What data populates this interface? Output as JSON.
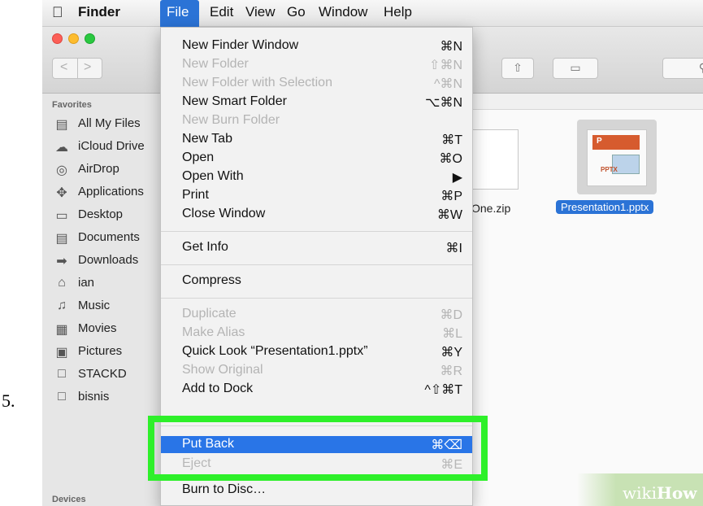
{
  "step_number": "5.",
  "menubar": {
    "apple_icon": "apple-logo",
    "app_name": "Finder",
    "items": [
      "File",
      "Edit",
      "View",
      "Go",
      "Window",
      "Help"
    ]
  },
  "toolbar": {
    "back_icon": "<",
    "forward_icon": ">",
    "share_icon": "share-icon",
    "tag_icon": "tag-icon",
    "search_icon": "search-icon"
  },
  "sidebar": {
    "favorites_heading": "Favorites",
    "devices_heading": "Devices",
    "items": [
      {
        "label": "All My Files",
        "icon": "all-files-icon"
      },
      {
        "label": "iCloud Drive",
        "icon": "cloud-icon"
      },
      {
        "label": "AirDrop",
        "icon": "airdrop-icon"
      },
      {
        "label": "Applications",
        "icon": "applications-icon"
      },
      {
        "label": "Desktop",
        "icon": "desktop-icon"
      },
      {
        "label": "Documents",
        "icon": "documents-icon"
      },
      {
        "label": "Downloads",
        "icon": "downloads-icon"
      },
      {
        "label": "ian",
        "icon": "home-icon"
      },
      {
        "label": "Music",
        "icon": "music-icon"
      },
      {
        "label": "Movies",
        "icon": "movies-icon"
      },
      {
        "label": "Pictures",
        "icon": "pictures-icon"
      },
      {
        "label": "STACKD",
        "icon": "folder-icon"
      },
      {
        "label": "bisnis",
        "icon": "folder-icon"
      }
    ]
  },
  "files": {
    "zip_label": "One.zip",
    "pptx_label": "Presentation1.pptx",
    "pptx_badge": "P",
    "pptx_tag": "PPTX"
  },
  "file_menu": {
    "items": [
      {
        "label": "New Finder Window",
        "shortcut": "⌘N",
        "enabled": true
      },
      {
        "label": "New Folder",
        "shortcut": "⇧⌘N",
        "enabled": false
      },
      {
        "label": "New Folder with Selection",
        "shortcut": "^⌘N",
        "enabled": false
      },
      {
        "label": "New Smart Folder",
        "shortcut": "⌥⌘N",
        "enabled": true
      },
      {
        "label": "New Burn Folder",
        "shortcut": "",
        "enabled": false
      },
      {
        "label": "New Tab",
        "shortcut": "⌘T",
        "enabled": true
      },
      {
        "label": "Open",
        "shortcut": "⌘O",
        "enabled": true
      },
      {
        "label": "Open With",
        "shortcut": "▶",
        "enabled": true
      },
      {
        "label": "Print",
        "shortcut": "⌘P",
        "enabled": true
      },
      {
        "label": "Close Window",
        "shortcut": "⌘W",
        "enabled": true
      },
      {
        "label": "Get Info",
        "shortcut": "⌘I",
        "enabled": true
      },
      {
        "label": "Compress",
        "shortcut": "",
        "enabled": true
      },
      {
        "label": "Duplicate",
        "shortcut": "⌘D",
        "enabled": false
      },
      {
        "label": "Make Alias",
        "shortcut": "⌘L",
        "enabled": false
      },
      {
        "label": "Quick Look “Presentation1.pptx”",
        "shortcut": "⌘Y",
        "enabled": true
      },
      {
        "label": "Show Original",
        "shortcut": "⌘R",
        "enabled": false
      },
      {
        "label": "Add to Dock",
        "shortcut": "^⇧⌘T",
        "enabled": true
      },
      {
        "label": "Put Back",
        "shortcut": "⌘⌫",
        "enabled": true,
        "highlighted": true
      },
      {
        "label": "Eject",
        "shortcut": "⌘E",
        "enabled": false
      },
      {
        "label": "Burn to Disc…",
        "shortcut": "",
        "enabled": true
      }
    ]
  },
  "highlight_color": "#2ef02a",
  "selection_color": "#1e6ee6",
  "watermark": {
    "text_a": "wiki",
    "text_b": "How"
  }
}
